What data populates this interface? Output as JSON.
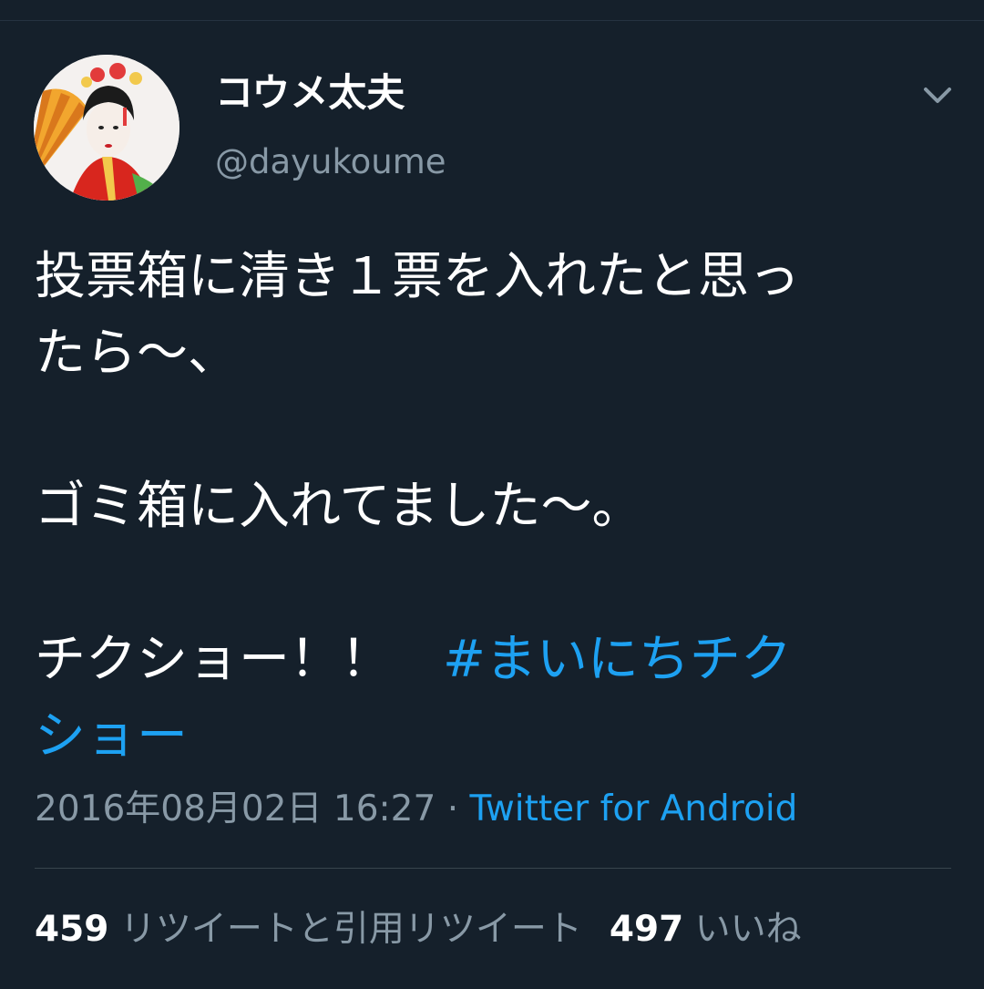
{
  "tweet": {
    "author": {
      "display_name": "コウメ太夫",
      "handle": "@dayukoume",
      "avatar_icon": "user-avatar-image"
    },
    "menu_icon": "chevron-down-icon",
    "text_lines": [
      "投票箱に清き１票を入れたと思っ",
      "たら〜、",
      "ゴミ箱に入れてました〜。",
      "チクショー！！　"
    ],
    "hashtag_part1": "#まいにちチク",
    "hashtag_part2": "ショー",
    "timestamp": "2016年08月02日 16:27",
    "separator": " · ",
    "source": "Twitter for Android",
    "retweets": {
      "count": "459",
      "label": "リツイートと引用リツイート"
    },
    "likes": {
      "count": "497",
      "label": "いいね"
    }
  },
  "colors": {
    "background": "#15202b",
    "link": "#1da1f2",
    "secondary_text": "#8899a6",
    "divider": "#38444d"
  }
}
